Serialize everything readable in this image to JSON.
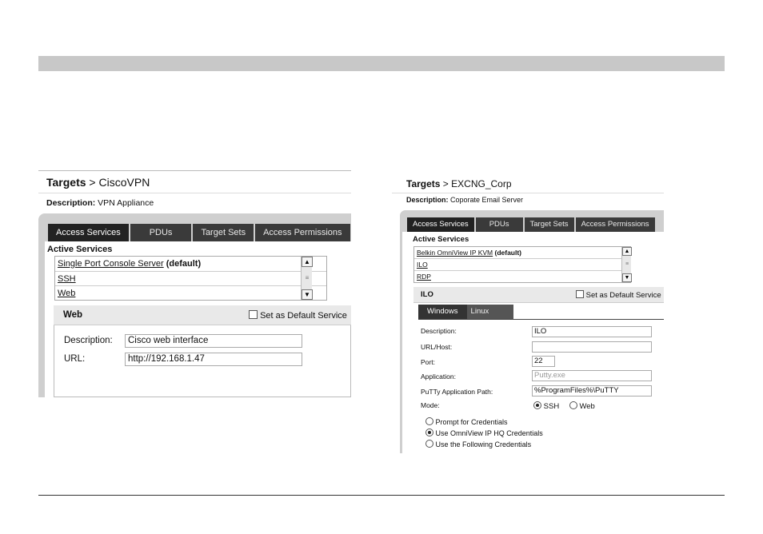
{
  "panel_left": {
    "breadcrumb_root": "Targets",
    "breadcrumb_sep": " > ",
    "breadcrumb_target": "CiscoVPN",
    "description_label": "Description:",
    "description_value": " VPN Appliance",
    "tabs": [
      "Access Services",
      "PDUs",
      "Target Sets",
      "Access Permissions"
    ],
    "active_services_label": "Active Services",
    "services": [
      {
        "name": "Single Port Console Server",
        "suffix": " (default)"
      },
      {
        "name": "SSH",
        "suffix": ""
      },
      {
        "name": "Web",
        "suffix": ""
      }
    ],
    "section_title": "Web",
    "default_service_label": "Set as Default Service",
    "fields": {
      "description_label": "Description:",
      "description_value": "Cisco web interface",
      "url_label": "URL:",
      "url_value": "http://192.168.1.47"
    }
  },
  "panel_right": {
    "breadcrumb_root": "Targets",
    "breadcrumb_sep": " > ",
    "breadcrumb_target": "EXCNG_Corp",
    "description_label": "Description:",
    "description_value": " Coporate Email Server",
    "tabs": [
      "Access Services",
      "PDUs",
      "Target Sets",
      "Access Permissions"
    ],
    "active_services_label": "Active Services",
    "services": [
      {
        "name": "Belkin OmniView IP KVM",
        "suffix": " (default)"
      },
      {
        "name": "ILO",
        "suffix": ""
      },
      {
        "name": "RDP",
        "suffix": ""
      }
    ],
    "section_title": "ILO",
    "default_service_label": "Set as Default Service",
    "os_tabs": [
      "Windows",
      "Linux"
    ],
    "fields": {
      "description_label": "Description:",
      "description_value": "ILO",
      "host_label": "URL/Host:",
      "host_value": "",
      "port_label": "Port:",
      "port_value": "22",
      "application_label": "Application:",
      "application_placeholder": "Putty.exe",
      "putty_path_label": "PuTTy Application Path:",
      "putty_path_value": "%ProgramFiles%\\PuTTY",
      "mode_label": "Mode:",
      "mode_options": [
        "SSH",
        "Web"
      ],
      "mode_selected": "SSH"
    },
    "credential_options": [
      "Prompt for Credentials",
      "Use OmniView IP HQ Credentials",
      "Use the Following Credentials"
    ],
    "credential_selected": "Use OmniView IP HQ Credentials"
  }
}
